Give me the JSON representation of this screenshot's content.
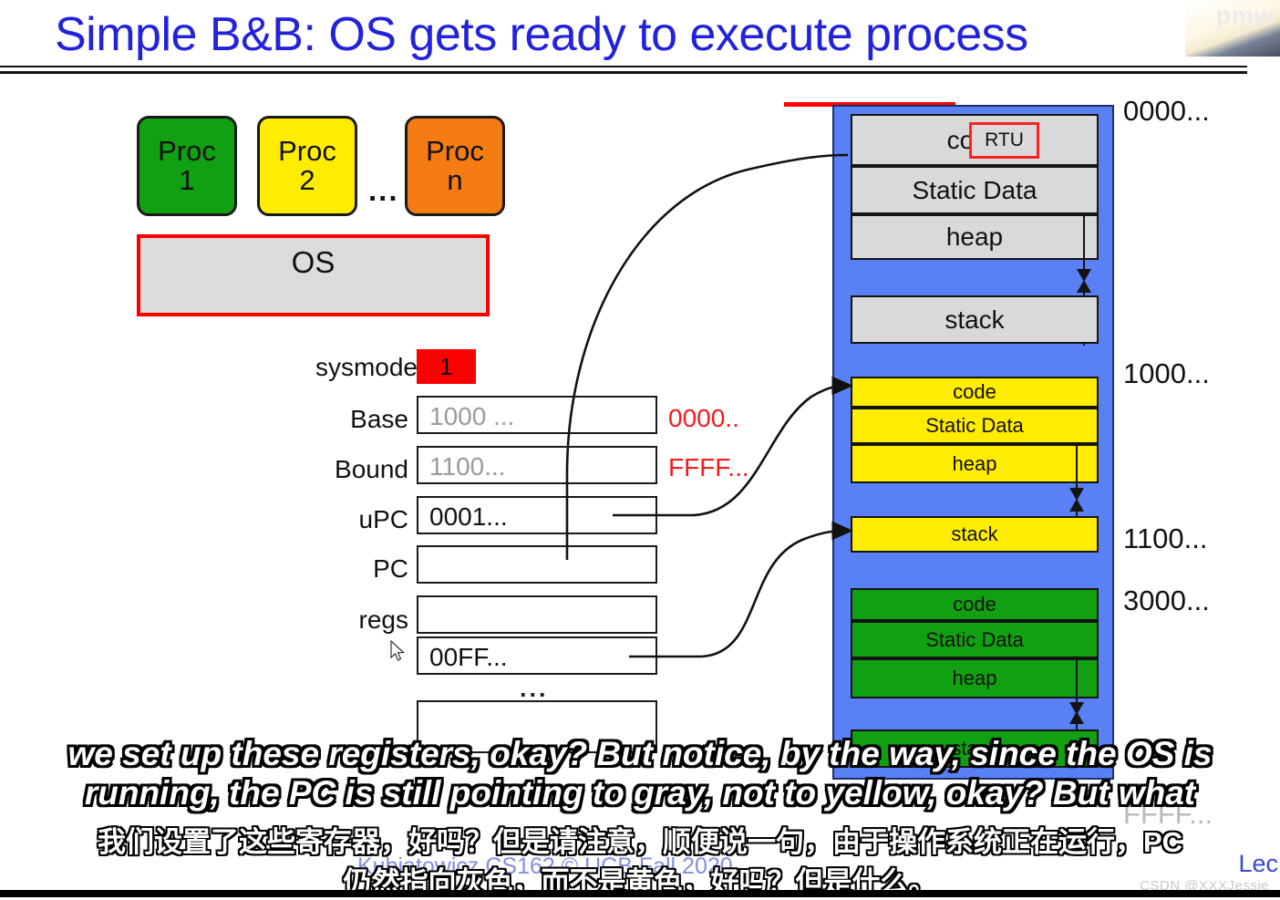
{
  "slide": {
    "title": "Simple B&B: OS gets ready to execute process",
    "corner_watermark": "pmw"
  },
  "processes": {
    "items": [
      {
        "name": "Proc",
        "number": "1",
        "color": "#11a011"
      },
      {
        "name": "Proc",
        "number": "2",
        "color": "#ffed00"
      },
      {
        "name": "Proc",
        "number": "n",
        "color": "#f57c13"
      }
    ],
    "ellipsis": "...",
    "os_label": "OS"
  },
  "registers": {
    "sysmode_label": "sysmode",
    "sysmode_value": "1",
    "sysmode_color": "#fa0000",
    "rows": [
      {
        "label": "Base",
        "value": "1000 ...",
        "dim": true
      },
      {
        "label": "Bound",
        "value": "1100...",
        "dim": true
      },
      {
        "label": "uPC",
        "value": "0001...",
        "dim": false
      },
      {
        "label": "PC",
        "value": "",
        "dim": false
      },
      {
        "label": "regs",
        "value": "",
        "dim": false
      }
    ],
    "regs_second_value": "00FF...",
    "ellipsis": "...",
    "red_annotations": [
      {
        "text": "0000..",
        "color": "#f71b1b"
      },
      {
        "text": "FFFF...",
        "color": "#f71b1b"
      }
    ]
  },
  "memory": {
    "background_color": "#5a80f5",
    "segments": [
      {
        "owner": "os",
        "color": "#d9d9d9",
        "blocks": [
          "code",
          "Static Data",
          "heap",
          "stack"
        ],
        "badge": "RTU"
      },
      {
        "owner": "proc2",
        "color": "#ffed00",
        "blocks": [
          "code",
          "Static Data",
          "heap",
          "stack"
        ]
      },
      {
        "owner": "proc1",
        "color": "#11a011",
        "blocks": [
          "code",
          "Static Data",
          "heap",
          "stack"
        ]
      }
    ],
    "address_ticks": [
      "0000...",
      "1000...",
      "1100...",
      "3000...",
      "FFFF..."
    ]
  },
  "subtitles": {
    "english": [
      "we set up these registers, okay? But notice, by the way, since the OS is",
      "running, the PC is still pointing to gray, not to yellow, okay? But what"
    ],
    "chinese": [
      "我们设置了这些寄存器，好吗？但是请注意，顺便说一句，由于操作系统正在运行，PC",
      "仍然指向灰色，而不是黄色，好吗？但是什么。"
    ]
  },
  "footer": {
    "citation": "Kubiatowicz CS162 © UCB Fall 2020",
    "lecture_tag": "Lec",
    "watermark": "CSDN @XXXJessie"
  }
}
